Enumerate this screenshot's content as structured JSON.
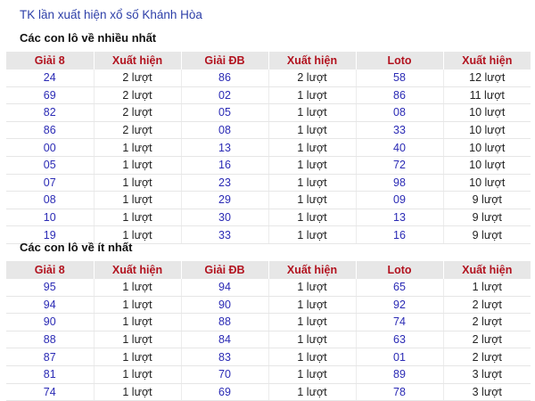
{
  "page": {
    "title": "TK lần xuất hiện xổ số Khánh Hòa"
  },
  "colors": {
    "title": "#2d3fa8",
    "header_text": "#b2131f",
    "header_bg": "#e7e7e7",
    "number_text": "#2b2bb5"
  },
  "sections": [
    {
      "title": "Các con lô về nhiều nhất",
      "headers": [
        "Giải 8",
        "Xuất hiện",
        "Giải ĐB",
        "Xuất hiện",
        "Loto",
        "Xuất hiện"
      ],
      "rows": [
        [
          "24",
          "2 lượt",
          "86",
          "2 lượt",
          "58",
          "12 lượt"
        ],
        [
          "69",
          "2 lượt",
          "02",
          "1 lượt",
          "86",
          "11 lượt"
        ],
        [
          "82",
          "2 lượt",
          "05",
          "1 lượt",
          "08",
          "10 lượt"
        ],
        [
          "86",
          "2 lượt",
          "08",
          "1 lượt",
          "33",
          "10 lượt"
        ],
        [
          "00",
          "1 lượt",
          "13",
          "1 lượt",
          "40",
          "10 lượt"
        ],
        [
          "05",
          "1 lượt",
          "16",
          "1 lượt",
          "72",
          "10 lượt"
        ],
        [
          "07",
          "1 lượt",
          "23",
          "1 lượt",
          "98",
          "10 lượt"
        ],
        [
          "08",
          "1 lượt",
          "29",
          "1 lượt",
          "09",
          "9 lượt"
        ],
        [
          "10",
          "1 lượt",
          "30",
          "1 lượt",
          "13",
          "9 lượt"
        ],
        [
          "19",
          "1 lượt",
          "33",
          "1 lượt",
          "16",
          "9 lượt"
        ]
      ]
    },
    {
      "title": "Các con lô về ít nhất",
      "headers": [
        "Giải 8",
        "Xuất hiện",
        "Giải ĐB",
        "Xuất hiện",
        "Loto",
        "Xuất hiện"
      ],
      "rows": [
        [
          "95",
          "1 lượt",
          "94",
          "1 lượt",
          "65",
          "1 lượt"
        ],
        [
          "94",
          "1 lượt",
          "90",
          "1 lượt",
          "92",
          "2 lượt"
        ],
        [
          "90",
          "1 lượt",
          "88",
          "1 lượt",
          "74",
          "2 lượt"
        ],
        [
          "88",
          "1 lượt",
          "84",
          "1 lượt",
          "63",
          "2 lượt"
        ],
        [
          "87",
          "1 lượt",
          "83",
          "1 lượt",
          "01",
          "2 lượt"
        ],
        [
          "81",
          "1 lượt",
          "70",
          "1 lượt",
          "89",
          "3 lượt"
        ],
        [
          "74",
          "1 lượt",
          "69",
          "1 lượt",
          "78",
          "3 lượt"
        ]
      ]
    }
  ]
}
